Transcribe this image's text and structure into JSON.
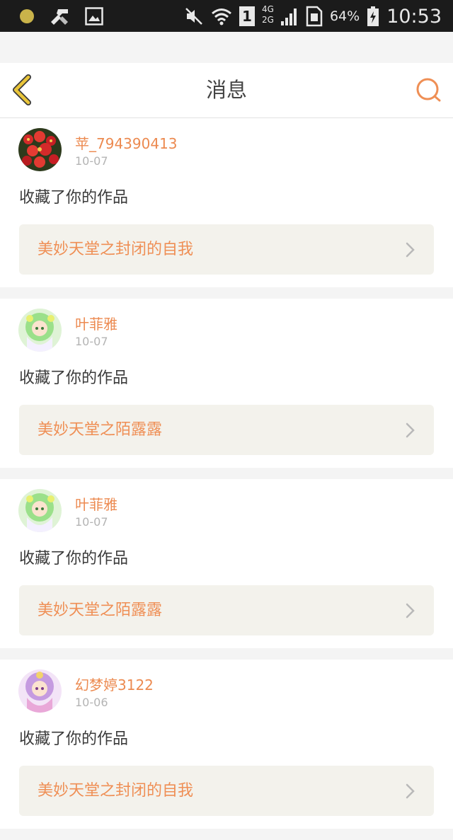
{
  "status_bar": {
    "network": "4G\n2G",
    "sim": "1",
    "battery": "64%",
    "time": "10:53"
  },
  "header": {
    "title": "消息"
  },
  "messages": [
    {
      "username": "苹_794390413",
      "date": "10-07",
      "action": "收藏了你的作品",
      "work_title": "美妙天堂之封闭的自我",
      "avatar": "red-flowers-avatar"
    },
    {
      "username": "叶菲雅",
      "date": "10-07",
      "action": "收藏了你的作品",
      "work_title": "美妙天堂之陌露露",
      "avatar": "anime-girl-green-avatar"
    },
    {
      "username": "叶菲雅",
      "date": "10-07",
      "action": "收藏了你的作品",
      "work_title": "美妙天堂之陌露露",
      "avatar": "anime-girl-green-avatar"
    },
    {
      "username": "幻梦婷3122",
      "date": "10-06",
      "action": "收藏了你的作品",
      "work_title": "美妙天堂之封闭的自我",
      "avatar": "anime-girl-purple-avatar"
    }
  ],
  "colors": {
    "accent": "#ec8a50",
    "back_arrow": "#e9c53a",
    "link_bg": "#f3f2ec"
  }
}
